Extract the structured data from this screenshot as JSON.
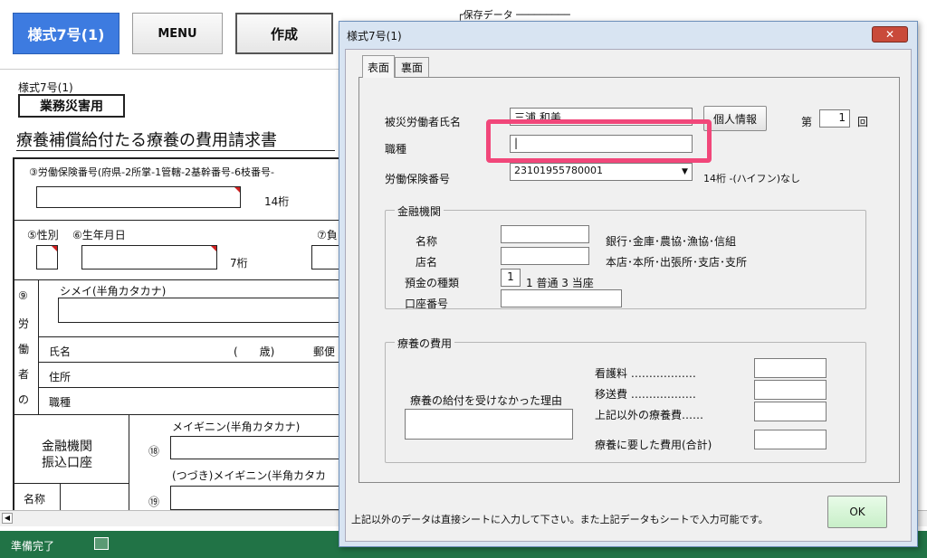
{
  "sheet": {
    "btn_form": "様式7号(1)",
    "btn_menu": "MENU",
    "btn_create": "作成",
    "save_data_label": "┌保存データ ─────────",
    "form_name": "様式7号(1)",
    "category": "業務災害用",
    "doc_title": "療養補償給付たる療養の費用請求書",
    "insurance_no_label": "③労働保険番号(府県-2所掌-1管轄-2基幹番号-6枝番号-",
    "digits14": "14桁",
    "sex_label": "⑤性別",
    "birth_label": "⑥生年月日",
    "digits7": "7桁",
    "field7": "⑦負",
    "kana_name_label": "シメイ(半角カタカナ)",
    "circle9": "⑨",
    "worker_chars": [
      "労",
      "働",
      "者",
      "の"
    ],
    "name_label": "氏名",
    "age_label": "(　　歳)",
    "postal_label": "郵便",
    "address_label": "住所",
    "job_label": "職種",
    "bank_label_1": "金融機関",
    "bank_label_2": "振込口座",
    "account_kana_label": "メイギニン(半角カタカナ)",
    "account_kana2_label": "(つづき)メイギニン(半角カタカ",
    "circle18": "⑱",
    "circle19": "⑲",
    "bank_name_label": "名称"
  },
  "status": {
    "ready": "準備完了"
  },
  "dialog": {
    "title": "様式7号(1)",
    "close": "✕",
    "tabs": [
      "表面",
      "裏面"
    ],
    "injured_name_label": "被災労働者氏名",
    "injured_name_value": "三浦 和美",
    "personal_info_button": "個人情報",
    "nth_prefix": "第",
    "nth_value": "1",
    "nth_suffix": "回",
    "job_label": "職種",
    "job_value": "|",
    "insurance_no_label": "労働保険番号",
    "insurance_no_value": "23101955780001",
    "insurance_note": "14桁 -(ハイフン)なし",
    "bank": {
      "group_title": "金融機関",
      "name_label": "名称",
      "name_note": "銀行･金庫･農協･漁協･信組",
      "branch_label": "店名",
      "branch_note": "本店･本所･出張所･支店･支所",
      "deposit_type_label": "預金の種類",
      "deposit_type_value": "1",
      "deposit_type_note": "1 普通 3 当座",
      "account_no_label": "口座番号"
    },
    "cost": {
      "group_title": "療養の費用",
      "nursing_label": "看護料 ‥‥‥‥‥‥‥‥‥",
      "transport_label": "移送費 ‥‥‥‥‥‥‥‥‥",
      "other_cost_label": "上記以外の療養費‥‥‥",
      "total_label": "療養に要した費用(合計)",
      "reason_label": "療養の給付を受けなかった理由"
    },
    "footer_note": "上記以外のデータは直接シートに入力して下さい。また上記データもシートで入力可能です。",
    "ok": "OK"
  }
}
